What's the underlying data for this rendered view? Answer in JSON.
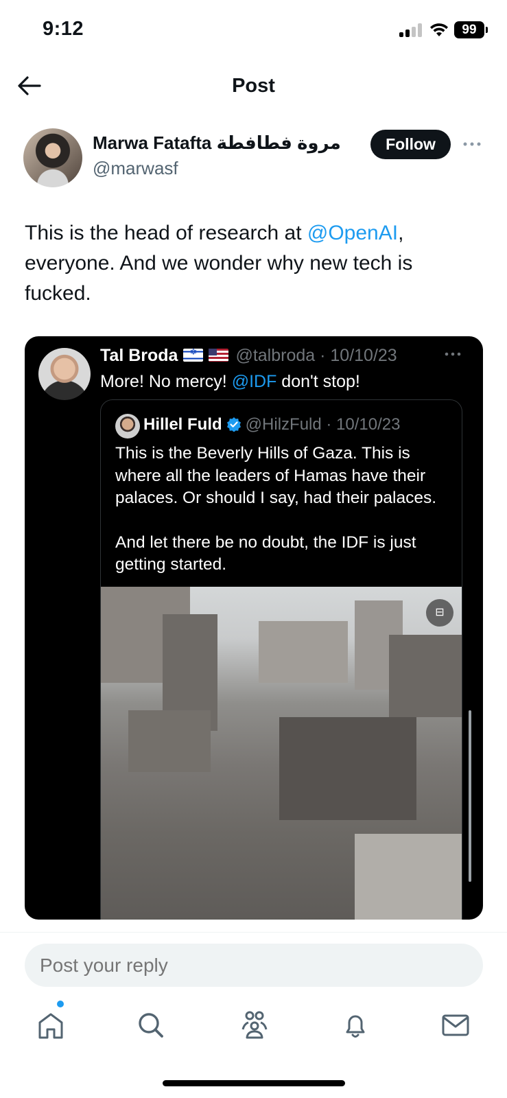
{
  "status_bar": {
    "time": "9:12",
    "battery": "99"
  },
  "header": {
    "title": "Post"
  },
  "author": {
    "name": "Marwa Fatafta مروة فطافطة",
    "handle": "@marwasf",
    "follow_label": "Follow"
  },
  "post": {
    "text_before": "This is the head of research at ",
    "mention": "@OpenAI",
    "text_after": ", everyone. And we wonder why new tech is fucked."
  },
  "quoted": {
    "name": "Tal Broda",
    "flags": [
      "israel-flag",
      "us-flag"
    ],
    "meta": "@talbroda · 10/10/23",
    "text_before": "More! No mercy! ",
    "mention": "@IDF",
    "text_after": " don't stop!",
    "inner": {
      "name": "Hillel Fuld",
      "verified": true,
      "meta": "@HilzFuld · 10/10/23",
      "paragraph_1": "This is the Beverly Hills of Gaza. This is where all the leaders of Hamas have their palaces. Or should I say, had their palaces.",
      "paragraph_2": "And let there be no doubt, the IDF is just getting started."
    }
  },
  "reply": {
    "placeholder": "Post your reply"
  },
  "nav": [
    "home-icon",
    "search-icon",
    "communities-icon",
    "notifications-icon",
    "messages-icon"
  ],
  "colors": {
    "accent": "#1d9bf0",
    "text": "#0f1419",
    "secondary": "#536471"
  }
}
